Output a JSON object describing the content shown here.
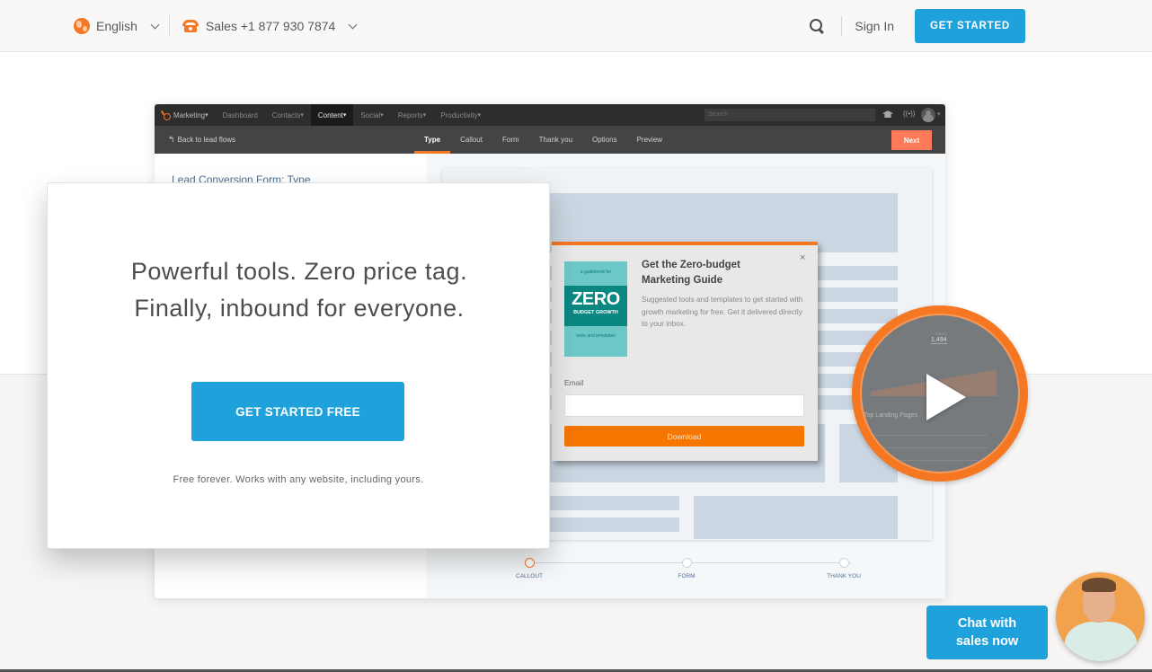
{
  "topbar": {
    "language": "English",
    "sales": "Sales +1 877 930 7874",
    "sign_in": "Sign In",
    "get_started": "GET STARTED"
  },
  "app": {
    "nav": {
      "items": [
        "Marketing",
        "Dashboard",
        "Contacts",
        "Content",
        "Social",
        "Reports",
        "Productivity"
      ],
      "active": "Content",
      "search_placeholder": "Search"
    },
    "subbar": {
      "back": "Back to lead flows",
      "tabs": [
        "Type",
        "Callout",
        "Form",
        "Thank you",
        "Options",
        "Preview"
      ],
      "active_tab": "Type",
      "next": "Next"
    },
    "left_title": "Lead Conversion Form: Type",
    "callout": {
      "book": {
        "top": "a guidebook for",
        "zero": "ZERO",
        "budget": "BUDGET GROWTH",
        "bottom": "tools and templates"
      },
      "title": "Get the Zero-budget Marketing Guide",
      "close": "×",
      "description": "Suggested tools and templates to get started with growth marketing for free. Get it delivered directly to your inbox.",
      "email_label": "Email",
      "email_value": "",
      "download": "Download"
    },
    "steps": [
      {
        "label": "CALLOUT",
        "active": true
      },
      {
        "label": "FORM",
        "active": false
      },
      {
        "label": "THANK YOU",
        "active": false
      }
    ]
  },
  "video": {
    "stat_label": "VISITS",
    "stat_value": "1,494",
    "heading": "Top Landing Pages"
  },
  "hero": {
    "title": "Powerful tools. Zero price tag. Finally, inbound for everyone.",
    "cta": "GET STARTED FREE",
    "note": "Free forever. Works with any website, including yours."
  },
  "chat": {
    "label_line1": "Chat with",
    "label_line2": "sales now"
  },
  "colors": {
    "primary_blue": "#1fa2dc",
    "accent_orange": "#f57722",
    "next_coral": "#ff7a59"
  }
}
